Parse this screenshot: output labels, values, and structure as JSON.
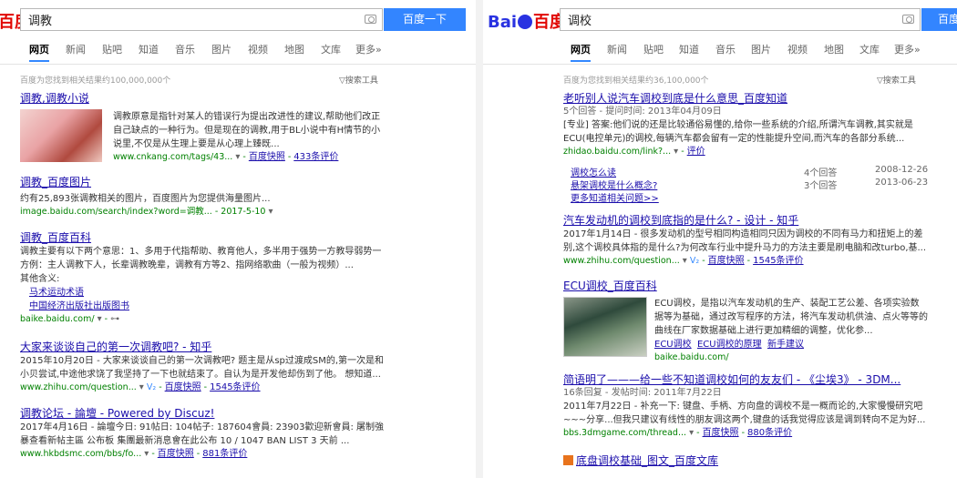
{
  "left": {
    "logo": {
      "text_red": "百度"
    },
    "query": "调教",
    "search_button": "百度一下",
    "tabs": [
      "网页",
      "新闻",
      "贴吧",
      "知道",
      "音乐",
      "图片",
      "视频",
      "地图",
      "文库",
      "更多»"
    ],
    "result_count": "百度为您找到相关结果约100,000,000个",
    "search_tools": "搜索工具",
    "results": [
      {
        "title": "调教,调教小说",
        "abstract": "调教原意是指针对某人的错误行为提出改进性的建议,帮助他们改正自己缺点的一种行为。但是现在的调教,用于BL小说中有H情节的小说里,不仅是从生理上要是从心理上臻既...",
        "url": "www.cnkang.com/tags/43...",
        "snapshot": "百度快照",
        "reviews": "433条评价"
      },
      {
        "title": "调教_百度图片",
        "abstract": "约有25,893张调教相关的图片，百度图片为您提供海量图片...",
        "url": "image.baidu.com/search/index?word=调教...",
        "date": "2017-5-10"
      },
      {
        "title": "调教_百度百科",
        "abstract": "调教主要有以下两个意思：1、多用于代指帮助、教育他人，多半用于强势一方教导弱势一方例：主人调教下人，长辈调教晚辈，调教有方等2、指网络歌曲（一般为视频）...",
        "other": "其他含义:",
        "sublinks": [
          "马术运动术语",
          "中国经济出版社出版图书"
        ],
        "url": "baike.baidu.com/"
      },
      {
        "title": "大家来谈谈自己的第一次调教吧? - 知乎",
        "abstract": "2015年10月20日 - 大家来谈谈自己的第一次调教吧? 题主是从sp过渡成SM的,第一次是和小贝尝试,中途他求饶了我坚持了一下也就结束了。自认为是开发他却伤到了他。 想知道...",
        "url": "www.zhihu.com/question...",
        "snapshot": "百度快照",
        "reviews": "1545条评价"
      },
      {
        "title": "调教论坛 - 論壇 - Powered by Discuz!",
        "abstract": "2017年4月16日 - 論壇今日: 91帖日: 104帖子: 187604會員: 23903歡迎新會員: 屠制強暴查看新帖主區 公布板 集團最新消息會在此公布 10 / 1047 BAN LIST 3 天前 ...",
        "url": "www.hkbdsmc.com/bbs/fo...",
        "snapshot": "百度快照",
        "reviews": "881条评价"
      }
    ]
  },
  "right": {
    "logo": {
      "text_blue": "Bai",
      "text_red": "百度"
    },
    "query": "调校",
    "search_button": "百度",
    "tabs": [
      "网页",
      "新闻",
      "贴吧",
      "知道",
      "音乐",
      "图片",
      "视频",
      "地图",
      "文库",
      "更多»"
    ],
    "result_count": "百度为您找到相关结果约36,100,000个",
    "search_tools": "搜索工具",
    "results": [
      {
        "title": "老听别人说汽车调校到底是什么意思_百度知道",
        "meta": "5个回答 - 提问时间: 2013年04月09日",
        "abstract": "[专业] 答案:他们说的还是比较通俗易懂的,给你一些系统的介绍,所谓汽车调教,其实就是ECU(电控单元)的调校,每辆汽车都会留有一定的性能提升空间,而汽车的各部分系统...",
        "url": "zhidao.baidu.com/link?...",
        "reviews": "评价",
        "related": [
          {
            "q": "调校怎么读",
            "answers": "4个回答",
            "date": "2008-12-26"
          },
          {
            "q": "悬架调校是什么概念?",
            "answers": "3个回答",
            "date": "2013-06-23"
          }
        ],
        "more": "更多知道相关问题>>"
      },
      {
        "title": "汽车发动机的调校到底指的是什么? - 设计 - 知乎",
        "abstract": "2017年1月14日 - 很多发动机的型号相同构造相同只因为调校的不同有马力和扭矩上的差别,这个调校具体指的是什么?为何改车行业中提升马力的方法主要是刷电脑和改turbo,基...",
        "url": "www.zhihu.com/question...",
        "snapshot": "百度快照",
        "reviews": "1545条评价"
      },
      {
        "title": "ECU调校_百度百科",
        "abstract": "ECU调校，是指以汽车发动机的生产、装配工艺公差、各项实验数据等为基础，通过改写程序的方法，将汽车发动机供油、点火等等的曲线在厂家数据基础上进行更加精细的调整，优化参...",
        "sublinks": [
          "ECU调校",
          "ECU调校的原理",
          "新手建议"
        ],
        "url": "baike.baidu.com/"
      },
      {
        "title": "简语明了———给一些不知道调校如何的友友们 - 《尘埃3》 - 3DM...",
        "meta": "16条回复 - 发帖时间: 2011年7月22日",
        "abstract": "2011年7月22日 - 补充一下: 键盘、手柄、方向盘的调校不是一概而论的,大家慢慢研究吧 ~~~分享...但我只建议有线性的朋友调这两个,键盘的话我觉得应该是调到转向不足为好...",
        "url": "bbs.3dmgame.com/thread...",
        "snapshot": "百度快照",
        "reviews": "880条评价"
      },
      {
        "title": "底盘调校基础_图文_百度文库"
      }
    ]
  },
  "colors": {
    "link": "#1a0dab",
    "highlight": "#c00",
    "url_green": "#008000",
    "brand_blue": "#3385ff",
    "brand_red": "#e10601"
  }
}
